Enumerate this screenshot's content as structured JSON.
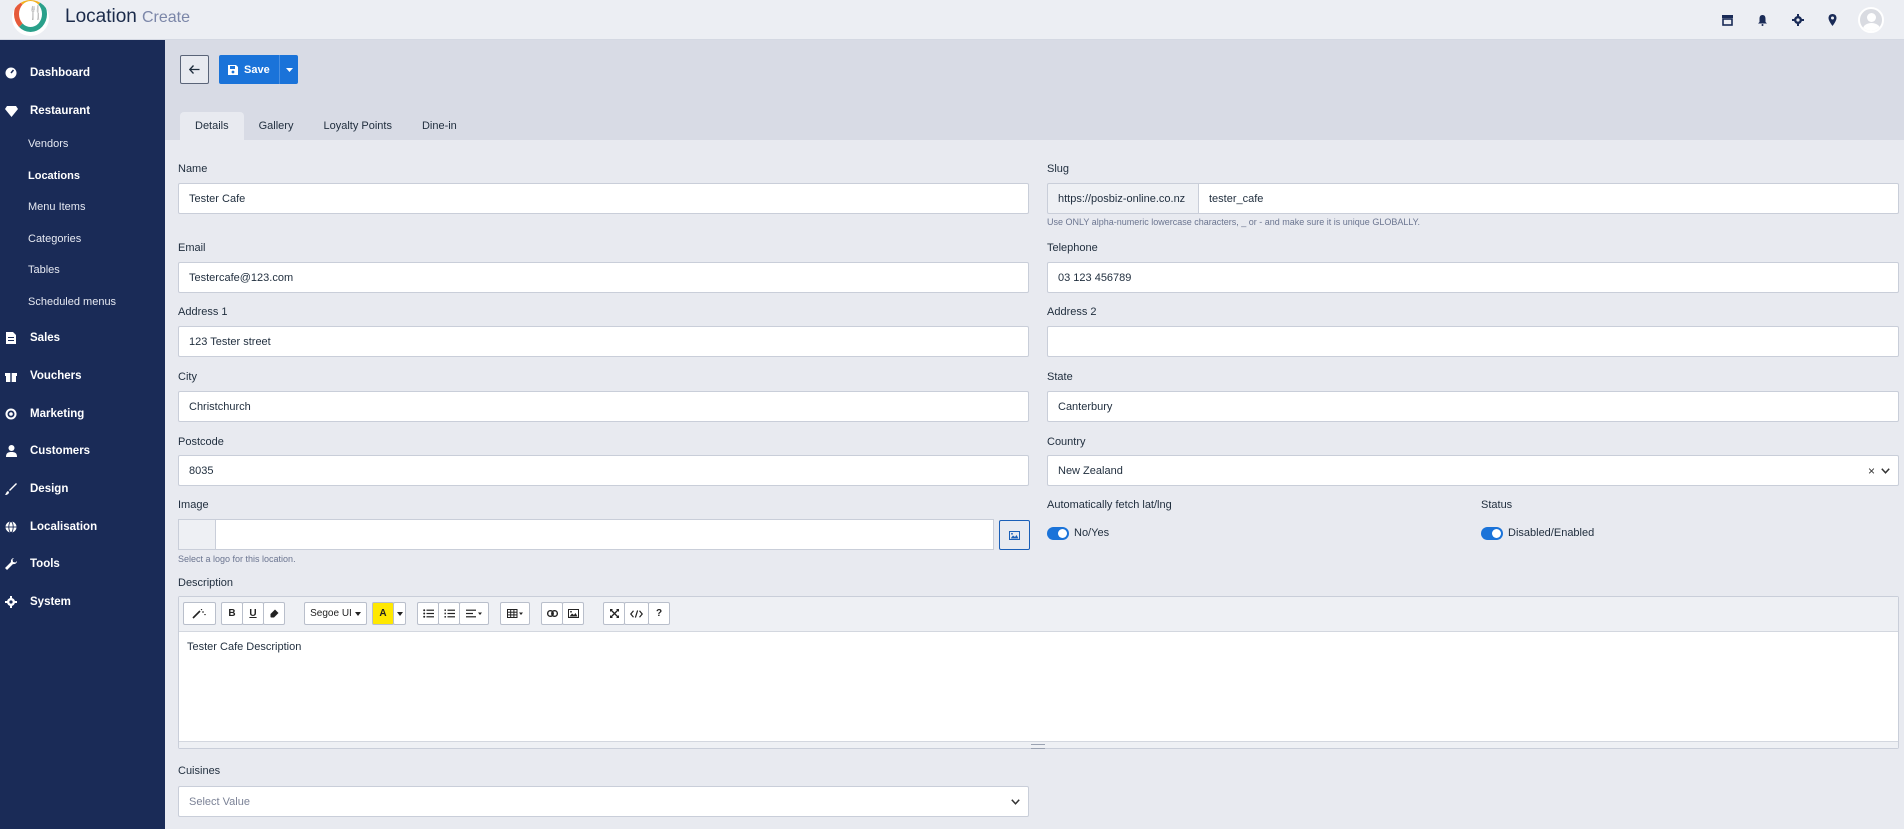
{
  "header": {
    "title": "Location",
    "subtitle": "Create",
    "icons": [
      "store-icon",
      "bell-icon",
      "gear-icon",
      "map-marker-icon",
      "user-avatar"
    ]
  },
  "sidebar": {
    "items": [
      {
        "label": "Dashboard",
        "icon": "dashboard-icon"
      },
      {
        "label": "Restaurant",
        "icon": "diamond-icon"
      },
      {
        "label": "Sales",
        "icon": "file-icon"
      },
      {
        "label": "Vouchers",
        "icon": "gift-icon"
      },
      {
        "label": "Marketing",
        "icon": "bullseye-icon"
      },
      {
        "label": "Customers",
        "icon": "user-icon"
      },
      {
        "label": "Design",
        "icon": "brush-icon"
      },
      {
        "label": "Localisation",
        "icon": "globe-icon"
      },
      {
        "label": "Tools",
        "icon": "wrench-icon"
      },
      {
        "label": "System",
        "icon": "cog-icon"
      }
    ],
    "restaurant_subitems": [
      "Vendors",
      "Locations",
      "Menu Items",
      "Categories",
      "Tables",
      "Scheduled menus"
    ],
    "active_subitem": "Locations"
  },
  "toolbar": {
    "save_label": "Save"
  },
  "tabs": [
    "Details",
    "Gallery",
    "Loyalty Points",
    "Dine-in"
  ],
  "active_tab": "Details",
  "form": {
    "name": {
      "label": "Name",
      "value": "Tester Cafe"
    },
    "slug": {
      "label": "Slug",
      "prefix": "https://posbiz-online.co.nz",
      "value": "tester_cafe",
      "help": "Use ONLY alpha-numeric lowercase characters, _ or - and make sure it is unique GLOBALLY."
    },
    "email": {
      "label": "Email",
      "value": "Testercafe@123.com"
    },
    "telephone": {
      "label": "Telephone",
      "value": "03 123 456789"
    },
    "address1": {
      "label": "Address 1",
      "value": "123 Tester street"
    },
    "address2": {
      "label": "Address 2",
      "value": ""
    },
    "city": {
      "label": "City",
      "value": "Christchurch"
    },
    "state": {
      "label": "State",
      "value": "Canterbury"
    },
    "postcode": {
      "label": "Postcode",
      "value": "8035"
    },
    "country": {
      "label": "Country",
      "value": "New Zealand",
      "clear": "×"
    },
    "image": {
      "label": "Image",
      "help": "Select a logo for this location."
    },
    "auto_latlng": {
      "label": "Automatically fetch lat/lng",
      "toggle_text": "No/Yes",
      "on": true
    },
    "status": {
      "label": "Status",
      "toggle_text": "Disabled/Enabled",
      "on": true
    },
    "description": {
      "label": "Description",
      "value": "Tester Cafe Description",
      "font_name": "Segoe UI"
    },
    "cuisines": {
      "label": "Cuisines",
      "placeholder": "Select Value"
    }
  },
  "colors": {
    "sidebar_bg": "#1a2b57",
    "primary": "#1a73d9",
    "header_band": "#d8dbe5",
    "page_bg": "#e8eaf0"
  }
}
